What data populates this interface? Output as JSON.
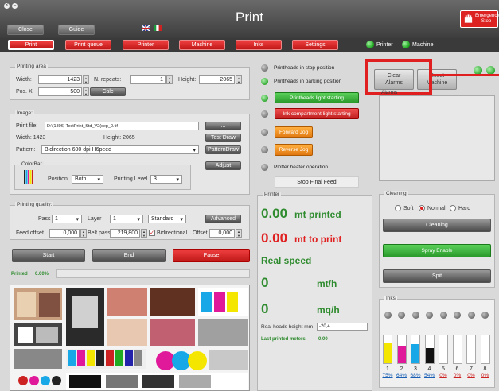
{
  "window": {
    "title": "Print",
    "close_label": "Close",
    "guide_label": "Guide",
    "estop_label": "Emergency Stop"
  },
  "nav": {
    "items": [
      "Print",
      "Print queue",
      "Printer",
      "Machine",
      "Inks",
      "Settings"
    ],
    "printer_label": "Printer",
    "machine_label": "Machine"
  },
  "printing_area": {
    "title": "Printing area",
    "width_label": "Width:",
    "width_value": "1423",
    "nrepeats_label": "N. repeats:",
    "nrepeats_value": "1",
    "height_label": "Height:",
    "height_value": "2065",
    "posx_label": "Pos. X:",
    "posx_value": "500",
    "calc_label": "Calc"
  },
  "image": {
    "title": "Image:",
    "file_label": "Print file:",
    "file_value": "D:\\[1806] TestPrint_Std_V2(sep_0.tif",
    "browse_label": "...",
    "width_text": "Width: 1423",
    "height_text": "Height: 2065",
    "test_draw_label": "Test Draw",
    "pattern_label": "Pattern:",
    "pattern_value": "Bidirection 600 dpi H6peed",
    "pattern_draw_label": "PatternDraw",
    "adjust_label": "Adjust",
    "colorbar_title": "ColorBar",
    "position_label": "Position",
    "position_value": "Both",
    "printing_level_label": "Printing Level",
    "printing_level_value": "3"
  },
  "quality": {
    "title": "Printing quality:",
    "pass_label": "Pass",
    "pass_value": "1",
    "layer_label": "Layer",
    "layer_value": "1",
    "mode_value": "Standard",
    "advanced_label": "Advanced",
    "feed_offset_label": "Feed offset",
    "feed_offset_value": "0,000",
    "belt_pass_label": "Belt pass",
    "belt_pass_value": "219,800",
    "bidirectional_label": "Bidirectional",
    "offset_label": "Offset",
    "offset_value": "0,000"
  },
  "controls": {
    "start_label": "Start",
    "end_label": "End",
    "pause_label": "Pause"
  },
  "progress": {
    "printed_label": "Printed",
    "percent": "0.00%"
  },
  "status": {
    "items": [
      "Printheads in stop position",
      "Printheads in parking position",
      "Printheads light starting",
      "Ink compartment light starting",
      "Forward Jog",
      "Reverse Jog",
      "Plotter heater operation"
    ],
    "stop_final_feed_label": "Stop Final Feed"
  },
  "printer": {
    "title": "Printer",
    "printed_value": "0.00",
    "printed_label": "mt printed",
    "to_print_value": "0.00",
    "to_print_label": "mt to print",
    "real_speed_label": "Real speed",
    "speed_value": "0",
    "speed_unit": "mt/h",
    "area_value": "0",
    "area_unit": "mq/h",
    "heads_height_label": "Real heads height mm",
    "heads_height_value": "-20,4",
    "last_printed_label": "Last printed meters",
    "last_printed_value": "0.00"
  },
  "alarms": {
    "clear_label_1": "Clear",
    "clear_label_2": "Alarms",
    "reset_label_1": "Reset",
    "reset_label_2": "Machine",
    "alarms_title": "Alarms"
  },
  "cleaning": {
    "title": "Cleaning",
    "soft_label": "Soft",
    "normal_label": "Normal",
    "hard_label": "Hard",
    "cleaning_label": "Cleaning",
    "spray_label": "Spray Enable",
    "spit_label": "Spit"
  },
  "inks": {
    "title": "Inks",
    "channels": [
      "1",
      "2",
      "3",
      "4",
      "5",
      "6",
      "7",
      "8"
    ],
    "percents": [
      "75%",
      "64%",
      "68%",
      "54%",
      "0%",
      "0%",
      "0%",
      "0%"
    ],
    "levels": [
      0.75,
      0.64,
      0.68,
      0.54,
      0,
      0,
      0,
      0
    ],
    "colors": [
      "#f5e600",
      "#e0189a",
      "#18a8e8",
      "#111111",
      "#cccccc",
      "#cccccc",
      "#cccccc",
      "#cccccc"
    ]
  },
  "colors": {
    "accent_red": "#e02020",
    "highlight_box": "#e02020",
    "status_green": "#2e8b2e"
  }
}
